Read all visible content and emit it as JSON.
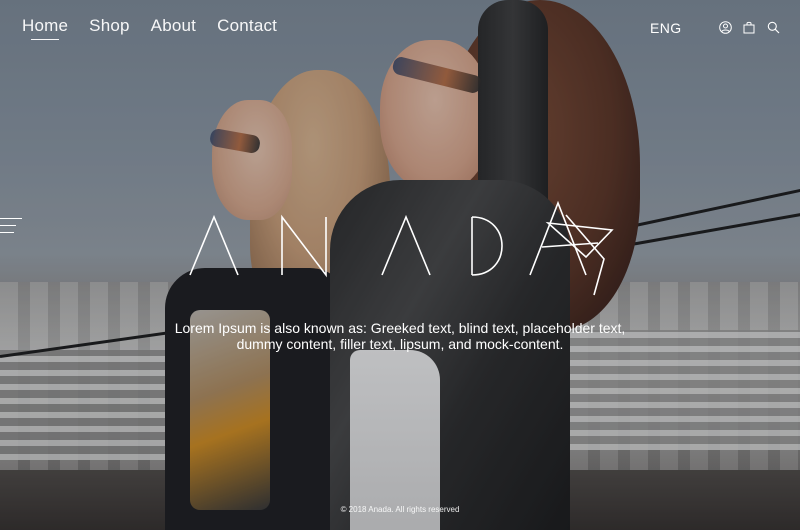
{
  "nav": {
    "items": [
      {
        "label": "Home",
        "active": true
      },
      {
        "label": "Shop",
        "active": false
      },
      {
        "label": "About",
        "active": false
      },
      {
        "label": "Contact",
        "active": false
      }
    ]
  },
  "header": {
    "language": "ENG",
    "icons": [
      "user-icon",
      "shopping-bag-icon",
      "search-icon"
    ]
  },
  "hero": {
    "brand": "ANADA",
    "tagline": "Lorem Ipsum is also known as: Greeked text, blind text, placeholder text, dummy content, filler text, lipsum, and mock-content."
  },
  "footer": {
    "copyright": "© 2018 Anada. All rights reserved"
  },
  "colors": {
    "text": "#ffffff",
    "overlay": "#141820"
  }
}
